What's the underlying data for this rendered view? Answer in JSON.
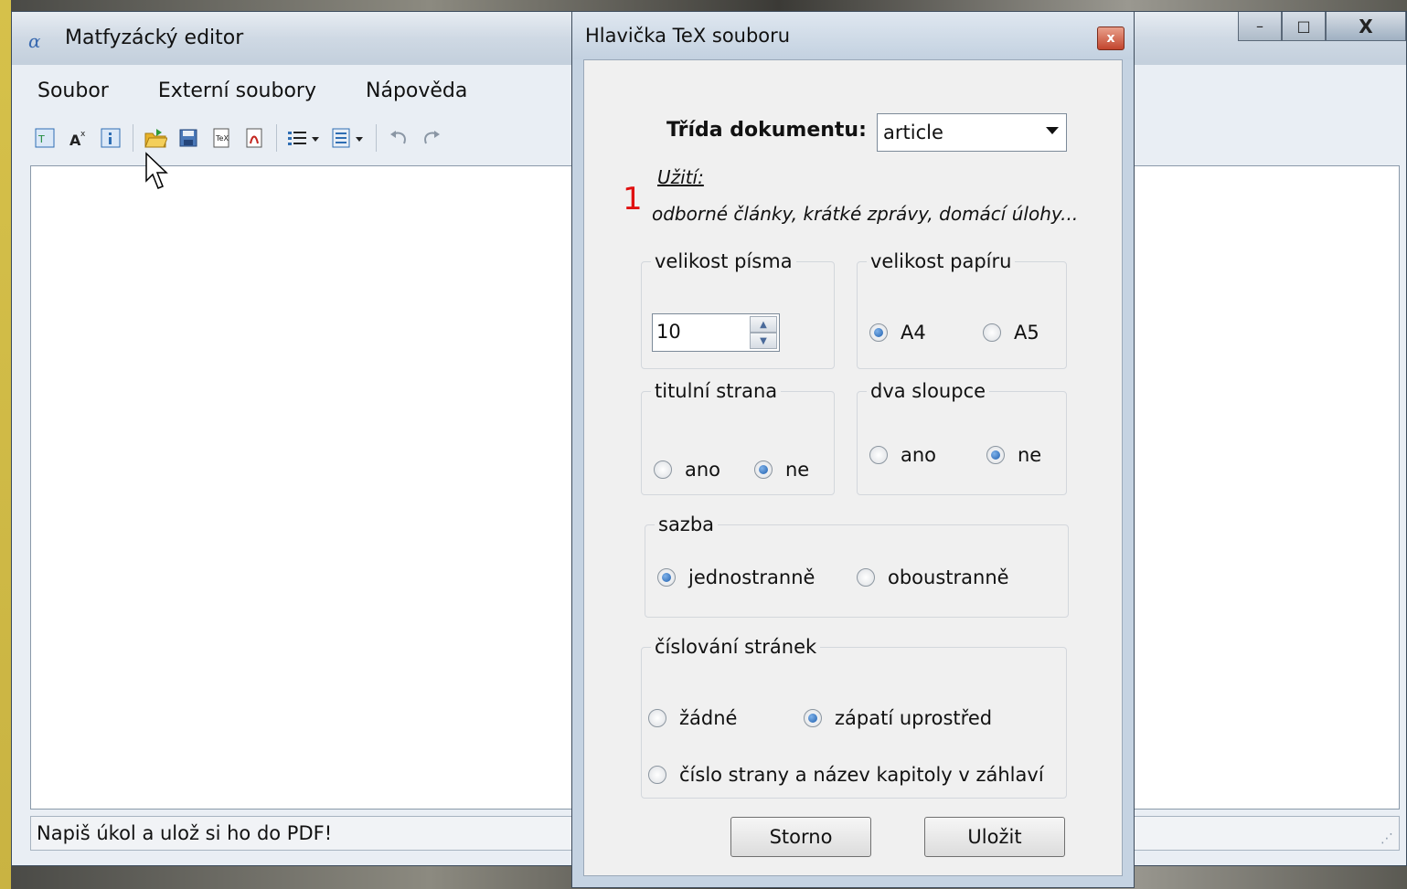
{
  "main_window": {
    "title": "Matfyzácký editor",
    "app_icon": "alpha-icon",
    "controls": {
      "minimize": "–",
      "maximize": "□",
      "close": "X"
    }
  },
  "menu": [
    "Soubor",
    "Externí soubory",
    "Nápověda"
  ],
  "toolbar": {
    "icons": [
      "tex-header-icon",
      "superscript-icon",
      "info-header-icon",
      "open-folder-icon",
      "save-icon",
      "tex-export-icon",
      "pdf-icon",
      "list-icon",
      "document-icon",
      "undo-icon",
      "redo-icon"
    ]
  },
  "statusbar": {
    "text": "Napiš úkol a ulož si ho do PDF!"
  },
  "dialog": {
    "title": "Hlavička TeX souboru",
    "doc_class_label": "Třída dokumentu:",
    "doc_class_value": "article",
    "usage_heading": "Užití:",
    "annotation": "1",
    "usage_text": "odborné články, krátké zprávy, domácí úlohy...",
    "font_size": {
      "legend": "velikost písma",
      "value": "10"
    },
    "paper_size": {
      "legend": "velikost papíru",
      "options": [
        "A4",
        "A5"
      ],
      "selected": "A4"
    },
    "title_page": {
      "legend": "titulní strana",
      "options": [
        "ano",
        "ne"
      ],
      "selected": "ne"
    },
    "two_columns": {
      "legend": "dva sloupce",
      "options": [
        "ano",
        "ne"
      ],
      "selected": "ne"
    },
    "typesetting": {
      "legend": "sazba",
      "options": [
        "jednostranně",
        "oboustranně"
      ],
      "selected": "jednostranně"
    },
    "page_numbering": {
      "legend": "číslování stránek",
      "options": [
        "žádné",
        "zápatí uprostřed",
        "číslo strany a název kapitoly v záhlaví"
      ],
      "selected": "zápatí uprostřed"
    },
    "buttons": {
      "cancel": "Storno",
      "save": "Uložit"
    }
  }
}
